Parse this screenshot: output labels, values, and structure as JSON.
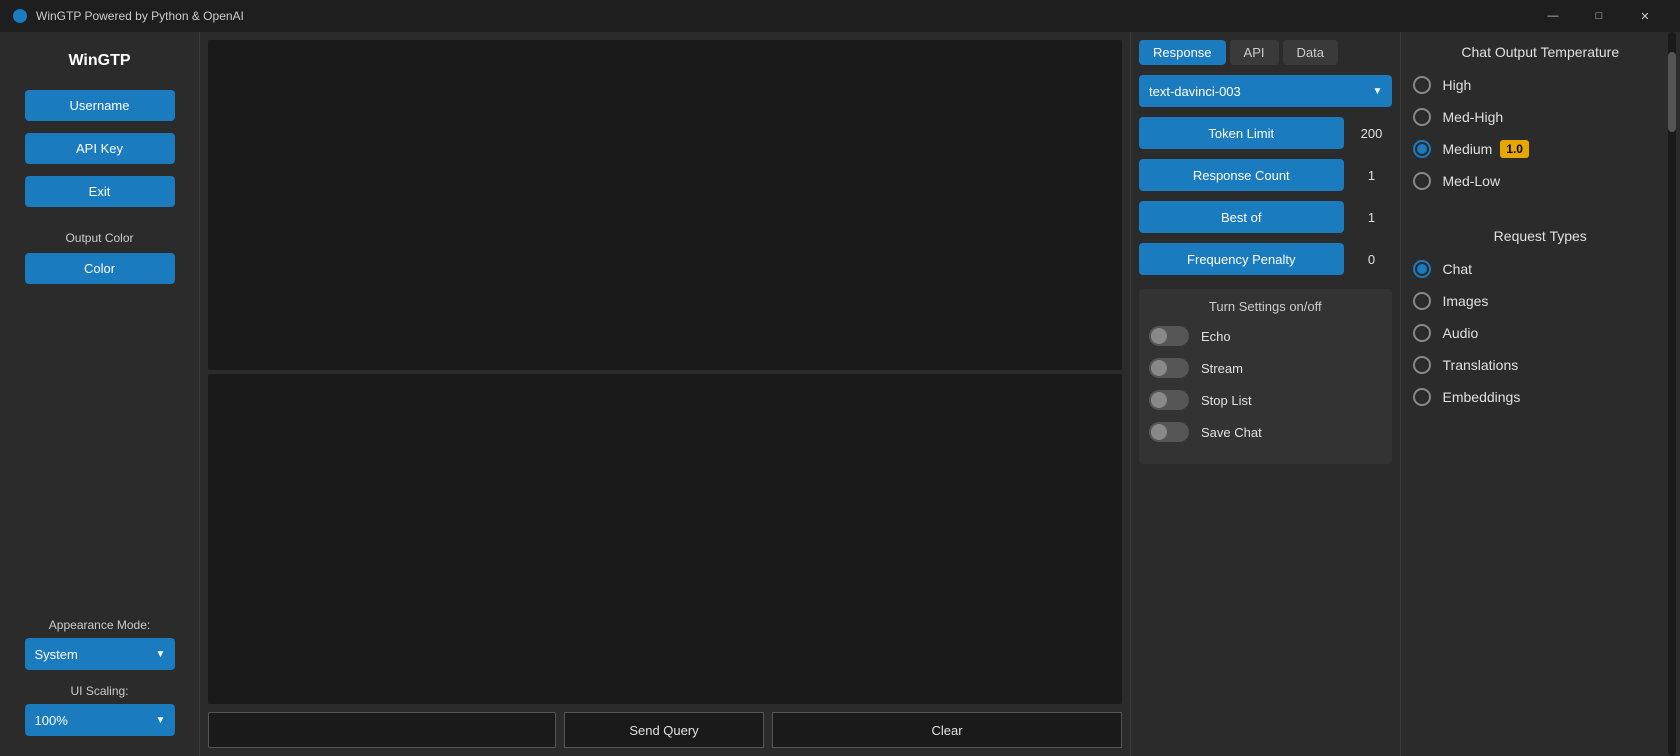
{
  "titlebar": {
    "title": "WinGTP Powered by Python & OpenAI",
    "minimize": "—",
    "maximize": "□",
    "close": "✕"
  },
  "sidebar": {
    "app_name": "WinGTP",
    "username_btn": "Username",
    "api_key_btn": "API Key",
    "exit_btn": "Exit",
    "output_color_label": "Output Color",
    "color_btn": "Color",
    "appearance_label": "Appearance Mode:",
    "appearance_value": "System",
    "ui_scaling_label": "UI Scaling:",
    "ui_scaling_value": "100%"
  },
  "tabs": {
    "response": "Response",
    "api": "API",
    "data": "Data"
  },
  "settings": {
    "model_value": "text-davinci-003",
    "token_limit_label": "Token Limit",
    "token_limit_value": "200",
    "response_count_label": "Response Count",
    "response_count_value": "1",
    "best_of_label": "Best of",
    "best_of_value": "1",
    "frequency_penalty_label": "Frequency Penalty",
    "frequency_penalty_value": "0"
  },
  "turn_settings": {
    "title": "Turn Settings on/off",
    "echo_label": "Echo",
    "echo_on": false,
    "stream_label": "Stream",
    "stream_on": false,
    "stop_list_label": "Stop List",
    "stop_list_on": false,
    "save_chat_label": "Save Chat",
    "save_chat_on": false
  },
  "temperature": {
    "title": "Chat Output Temperature",
    "options": [
      {
        "label": "High",
        "value": "high",
        "selected": false,
        "badge": null
      },
      {
        "label": "Med-High",
        "value": "med-high",
        "selected": false,
        "badge": null
      },
      {
        "label": "Medium",
        "value": "medium",
        "selected": true,
        "badge": "1.0"
      },
      {
        "label": "Med-Low",
        "value": "med-low",
        "selected": false,
        "badge": null
      }
    ]
  },
  "request_types": {
    "title": "Request Types",
    "options": [
      {
        "label": "Chat",
        "selected": true
      },
      {
        "label": "Images",
        "selected": false
      },
      {
        "label": "Audio",
        "selected": false
      },
      {
        "label": "Translations",
        "selected": false
      },
      {
        "label": "Embeddings",
        "selected": false
      }
    ]
  },
  "bottom": {
    "query_placeholder": "",
    "send_label": "Send Query",
    "clear_label": "Clear"
  }
}
